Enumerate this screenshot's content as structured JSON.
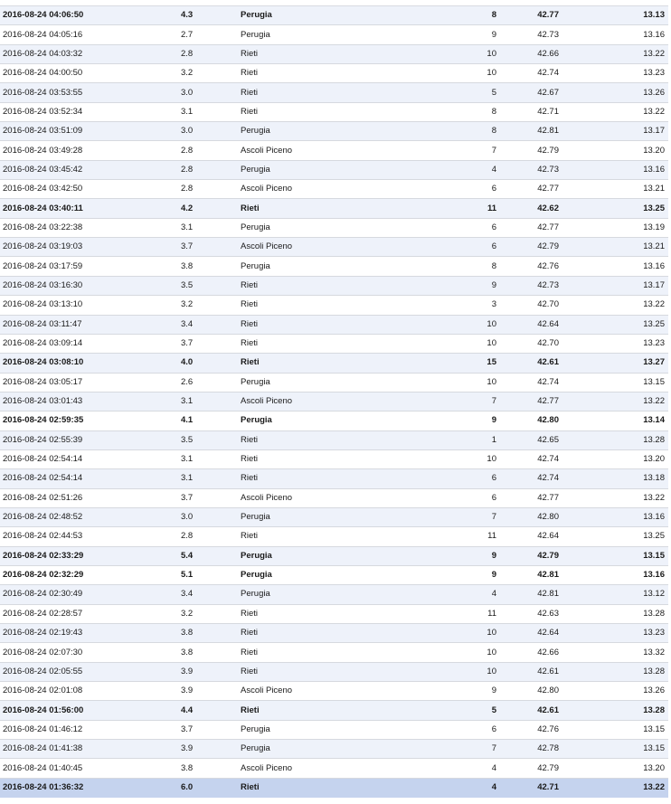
{
  "earthquakes": {
    "rows": [
      {
        "time": "2016-08-24 04:06:50",
        "magnitude": "4.3",
        "area": "Perugia",
        "depth": "8",
        "latitude": "42.77",
        "longitude": "13.13",
        "strong": true
      },
      {
        "time": "2016-08-24 04:05:16",
        "magnitude": "2.7",
        "area": "Perugia",
        "depth": "9",
        "latitude": "42.73",
        "longitude": "13.16",
        "strong": false
      },
      {
        "time": "2016-08-24 04:03:32",
        "magnitude": "2.8",
        "area": "Rieti",
        "depth": "10",
        "latitude": "42.66",
        "longitude": "13.22",
        "strong": false
      },
      {
        "time": "2016-08-24 04:00:50",
        "magnitude": "3.2",
        "area": "Rieti",
        "depth": "10",
        "latitude": "42.74",
        "longitude": "13.23",
        "strong": false
      },
      {
        "time": "2016-08-24 03:53:55",
        "magnitude": "3.0",
        "area": "Rieti",
        "depth": "5",
        "latitude": "42.67",
        "longitude": "13.26",
        "strong": false
      },
      {
        "time": "2016-08-24 03:52:34",
        "magnitude": "3.1",
        "area": "Rieti",
        "depth": "8",
        "latitude": "42.71",
        "longitude": "13.22",
        "strong": false
      },
      {
        "time": "2016-08-24 03:51:09",
        "magnitude": "3.0",
        "area": "Perugia",
        "depth": "8",
        "latitude": "42.81",
        "longitude": "13.17",
        "strong": false
      },
      {
        "time": "2016-08-24 03:49:28",
        "magnitude": "2.8",
        "area": "Ascoli Piceno",
        "depth": "7",
        "latitude": "42.79",
        "longitude": "13.20",
        "strong": false
      },
      {
        "time": "2016-08-24 03:45:42",
        "magnitude": "2.8",
        "area": "Perugia",
        "depth": "4",
        "latitude": "42.73",
        "longitude": "13.16",
        "strong": false
      },
      {
        "time": "2016-08-24 03:42:50",
        "magnitude": "2.8",
        "area": "Ascoli Piceno",
        "depth": "6",
        "latitude": "42.77",
        "longitude": "13.21",
        "strong": false
      },
      {
        "time": "2016-08-24 03:40:11",
        "magnitude": "4.2",
        "area": "Rieti",
        "depth": "11",
        "latitude": "42.62",
        "longitude": "13.25",
        "strong": true
      },
      {
        "time": "2016-08-24 03:22:38",
        "magnitude": "3.1",
        "area": "Perugia",
        "depth": "6",
        "latitude": "42.77",
        "longitude": "13.19",
        "strong": false
      },
      {
        "time": "2016-08-24 03:19:03",
        "magnitude": "3.7",
        "area": "Ascoli Piceno",
        "depth": "6",
        "latitude": "42.79",
        "longitude": "13.21",
        "strong": false
      },
      {
        "time": "2016-08-24 03:17:59",
        "magnitude": "3.8",
        "area": "Perugia",
        "depth": "8",
        "latitude": "42.76",
        "longitude": "13.16",
        "strong": false
      },
      {
        "time": "2016-08-24 03:16:30",
        "magnitude": "3.5",
        "area": "Rieti",
        "depth": "9",
        "latitude": "42.73",
        "longitude": "13.17",
        "strong": false
      },
      {
        "time": "2016-08-24 03:13:10",
        "magnitude": "3.2",
        "area": "Rieti",
        "depth": "3",
        "latitude": "42.70",
        "longitude": "13.22",
        "strong": false
      },
      {
        "time": "2016-08-24 03:11:47",
        "magnitude": "3.4",
        "area": "Rieti",
        "depth": "10",
        "latitude": "42.64",
        "longitude": "13.25",
        "strong": false
      },
      {
        "time": "2016-08-24 03:09:14",
        "magnitude": "3.7",
        "area": "Rieti",
        "depth": "10",
        "latitude": "42.70",
        "longitude": "13.23",
        "strong": false
      },
      {
        "time": "2016-08-24 03:08:10",
        "magnitude": "4.0",
        "area": "Rieti",
        "depth": "15",
        "latitude": "42.61",
        "longitude": "13.27",
        "strong": true
      },
      {
        "time": "2016-08-24 03:05:17",
        "magnitude": "2.6",
        "area": "Perugia",
        "depth": "10",
        "latitude": "42.74",
        "longitude": "13.15",
        "strong": false
      },
      {
        "time": "2016-08-24 03:01:43",
        "magnitude": "3.1",
        "area": "Ascoli Piceno",
        "depth": "7",
        "latitude": "42.77",
        "longitude": "13.22",
        "strong": false
      },
      {
        "time": "2016-08-24 02:59:35",
        "magnitude": "4.1",
        "area": "Perugia",
        "depth": "9",
        "latitude": "42.80",
        "longitude": "13.14",
        "strong": true
      },
      {
        "time": "2016-08-24 02:55:39",
        "magnitude": "3.5",
        "area": "Rieti",
        "depth": "1",
        "latitude": "42.65",
        "longitude": "13.28",
        "strong": false
      },
      {
        "time": "2016-08-24 02:54:14",
        "magnitude": "3.1",
        "area": "Rieti",
        "depth": "10",
        "latitude": "42.74",
        "longitude": "13.20",
        "strong": false
      },
      {
        "time": "2016-08-24 02:54:14",
        "magnitude": "3.1",
        "area": "Rieti",
        "depth": "6",
        "latitude": "42.74",
        "longitude": "13.18",
        "strong": false
      },
      {
        "time": "2016-08-24 02:51:26",
        "magnitude": "3.7",
        "area": "Ascoli Piceno",
        "depth": "6",
        "latitude": "42.77",
        "longitude": "13.22",
        "strong": false
      },
      {
        "time": "2016-08-24 02:48:52",
        "magnitude": "3.0",
        "area": "Perugia",
        "depth": "7",
        "latitude": "42.80",
        "longitude": "13.16",
        "strong": false
      },
      {
        "time": "2016-08-24 02:44:53",
        "magnitude": "2.8",
        "area": "Rieti",
        "depth": "11",
        "latitude": "42.64",
        "longitude": "13.25",
        "strong": false
      },
      {
        "time": "2016-08-24 02:33:29",
        "magnitude": "5.4",
        "area": "Perugia",
        "depth": "9",
        "latitude": "42.79",
        "longitude": "13.15",
        "strong": true
      },
      {
        "time": "2016-08-24 02:32:29",
        "magnitude": "5.1",
        "area": "Perugia",
        "depth": "9",
        "latitude": "42.81",
        "longitude": "13.16",
        "strong": true
      },
      {
        "time": "2016-08-24 02:30:49",
        "magnitude": "3.4",
        "area": "Perugia",
        "depth": "4",
        "latitude": "42.81",
        "longitude": "13.12",
        "strong": false
      },
      {
        "time": "2016-08-24 02:28:57",
        "magnitude": "3.2",
        "area": "Rieti",
        "depth": "11",
        "latitude": "42.63",
        "longitude": "13.28",
        "strong": false
      },
      {
        "time": "2016-08-24 02:19:43",
        "magnitude": "3.8",
        "area": "Rieti",
        "depth": "10",
        "latitude": "42.64",
        "longitude": "13.23",
        "strong": false
      },
      {
        "time": "2016-08-24 02:07:30",
        "magnitude": "3.8",
        "area": "Rieti",
        "depth": "10",
        "latitude": "42.66",
        "longitude": "13.32",
        "strong": false
      },
      {
        "time": "2016-08-24 02:05:55",
        "magnitude": "3.9",
        "area": "Rieti",
        "depth": "10",
        "latitude": "42.61",
        "longitude": "13.28",
        "strong": false
      },
      {
        "time": "2016-08-24 02:01:08",
        "magnitude": "3.9",
        "area": "Ascoli Piceno",
        "depth": "9",
        "latitude": "42.80",
        "longitude": "13.26",
        "strong": false
      },
      {
        "time": "2016-08-24 01:56:00",
        "magnitude": "4.4",
        "area": "Rieti",
        "depth": "5",
        "latitude": "42.61",
        "longitude": "13.28",
        "strong": true
      },
      {
        "time": "2016-08-24 01:46:12",
        "magnitude": "3.7",
        "area": "Perugia",
        "depth": "6",
        "latitude": "42.76",
        "longitude": "13.15",
        "strong": false
      },
      {
        "time": "2016-08-24 01:41:38",
        "magnitude": "3.9",
        "area": "Perugia",
        "depth": "7",
        "latitude": "42.78",
        "longitude": "13.15",
        "strong": false
      },
      {
        "time": "2016-08-24 01:40:45",
        "magnitude": "3.8",
        "area": "Ascoli Piceno",
        "depth": "4",
        "latitude": "42.79",
        "longitude": "13.20",
        "strong": false
      },
      {
        "time": "2016-08-24 01:36:32",
        "magnitude": "6.0",
        "area": "Rieti",
        "depth": "4",
        "latitude": "42.71",
        "longitude": "13.22",
        "strong": true,
        "selected": true
      }
    ]
  },
  "colors": {
    "row_even": "#eef2fa",
    "row_odd": "#ffffff",
    "row_selected": "#c5d3ee",
    "grid_line": "#d6d9df",
    "text": "#1a1a1a"
  }
}
